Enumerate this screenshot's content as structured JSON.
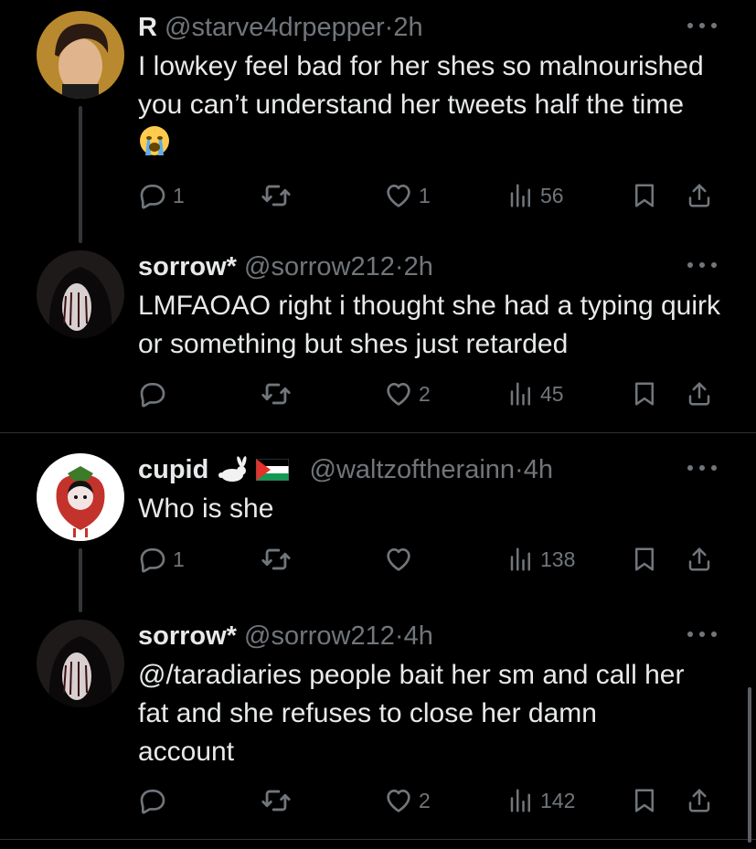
{
  "tweets": [
    {
      "name": "R",
      "handle": "@starve4drpepper",
      "time": "2h",
      "text": "I lowkey feel bad for her shes so malnourished you can’t understand her tweets half the time",
      "emoji": "loudly-crying-face",
      "replies": "1",
      "reposts": "",
      "likes": "1",
      "views": "56"
    },
    {
      "name": "sorrow*",
      "handle": "@sorrow212",
      "time": "2h",
      "text": "LMFAOAO right i thought she had a typing quirk or something but shes just retarded",
      "replies": "",
      "reposts": "",
      "likes": "2",
      "views": "45"
    },
    {
      "name": "cupid",
      "name_icons": [
        "rabbit-emoji",
        "palestine-flag"
      ],
      "handle": "@waltzoftherainn",
      "time": "4h",
      "text": "Who is she",
      "replies": "1",
      "reposts": "",
      "likes": "",
      "views": "138"
    },
    {
      "name": "sorrow*",
      "handle": "@sorrow212",
      "time": "4h",
      "text": "@/taradiaries people bait her sm and call her fat and she refuses to close her damn account",
      "replies": "",
      "reposts": "",
      "likes": "2",
      "views": "142"
    }
  ],
  "separator": "·",
  "colors": {
    "background": "#000000",
    "text": "#e7e9ea",
    "muted": "#71767b",
    "divider": "#2f3336"
  }
}
